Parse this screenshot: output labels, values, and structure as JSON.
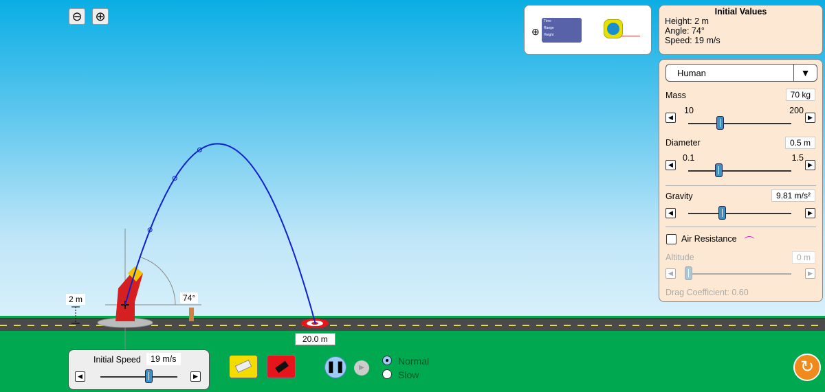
{
  "zoom": {
    "out_icon": "zoom-out-icon",
    "in_icon": "zoom-in-icon"
  },
  "tools": {
    "readout": {
      "rows": [
        "Time",
        "Range",
        "Height"
      ],
      "values": [
        "-",
        "-",
        "-"
      ]
    },
    "tape_icon": "tape-measure-icon"
  },
  "initial_values": {
    "title": "Initial Values",
    "height": "Height: 2 m",
    "angle": "Angle: 74°",
    "speed": "Speed: 19 m/s"
  },
  "controls": {
    "projectile": "Human",
    "mass": {
      "label": "Mass",
      "value": "70 kg",
      "min": "10",
      "max": "200",
      "fraction": 0.25
    },
    "diameter": {
      "label": "Diameter",
      "value": "0.5 m",
      "min": "0.1",
      "max": "1.5",
      "fraction": 0.29
    },
    "gravity": {
      "label": "Gravity",
      "value": "9.81 m/s²",
      "fraction": 0.33
    },
    "air_resistance": {
      "label": "Air Resistance",
      "checked": false
    },
    "altitude": {
      "label": "Altitude",
      "value": "0 m",
      "fraction": 0
    },
    "drag": "Drag Coefficient: 0.60"
  },
  "scene": {
    "height_label": "2 m",
    "angle_label": "74°",
    "range_label": "20.0 m",
    "launch": {
      "height_m": 2,
      "angle_deg": 74,
      "speed_mps": 19,
      "gravity": 9.81
    }
  },
  "speed_panel": {
    "label": "Initial Speed",
    "value": "19 m/s",
    "fraction": 0.6
  },
  "playback": {
    "normal": "Normal",
    "slow": "Slow",
    "selected": "Normal"
  },
  "colors": {
    "trajectory": "#1020d0",
    "eraser": "#f5dc00",
    "fire": "#e8141c",
    "reset": "#f08a1c"
  }
}
